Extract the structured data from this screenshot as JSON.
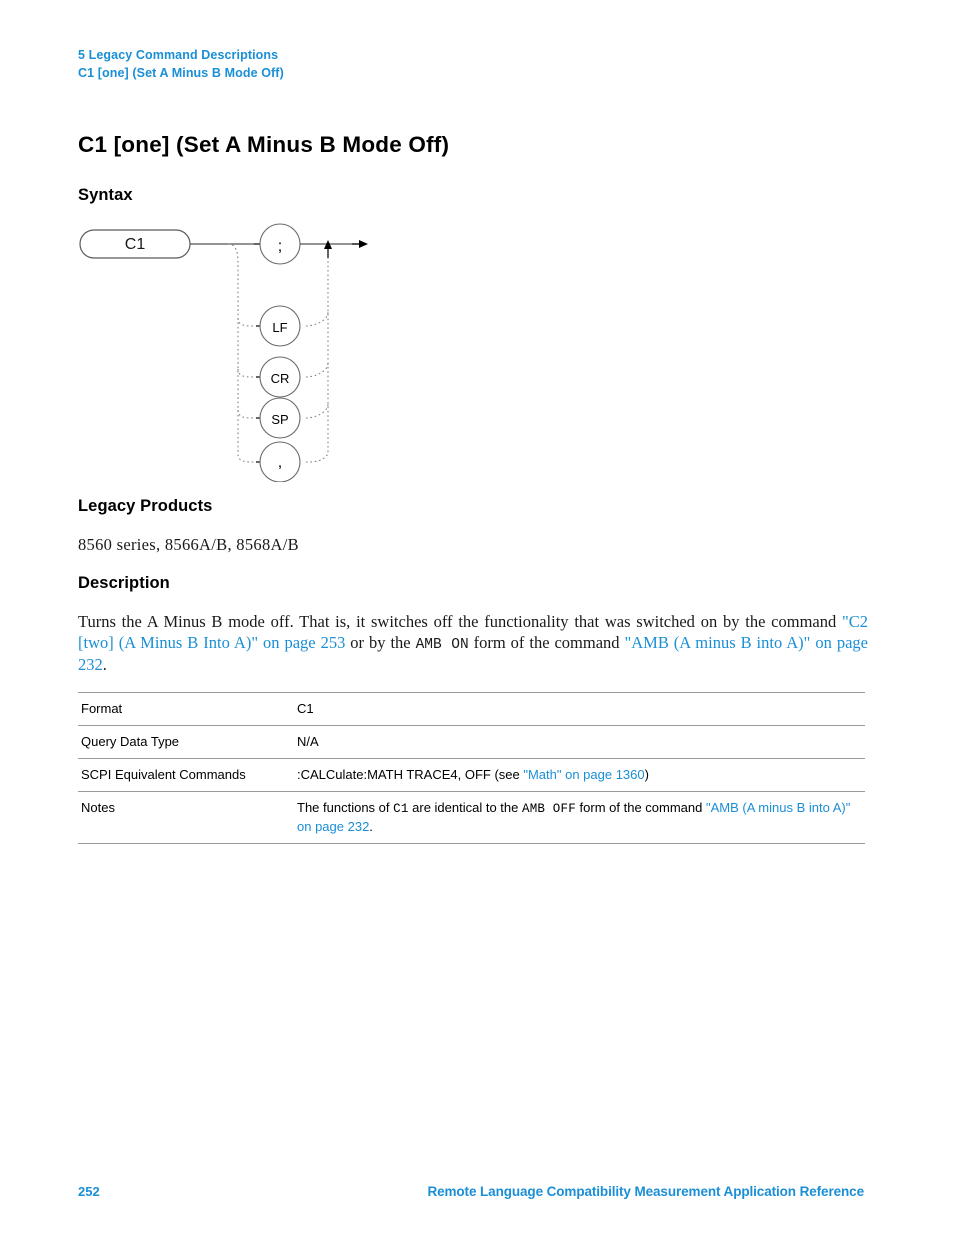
{
  "header": {
    "chapter": "5  Legacy Command Descriptions",
    "section": "C1 [one] (Set A Minus B Mode Off)"
  },
  "title": "C1 [one] (Set A Minus B Mode Off)",
  "sections": {
    "syntax_heading": "Syntax",
    "legacy_heading": "Legacy Products",
    "legacy_products": "8560 series, 8566A/B, 8568A/B",
    "description_heading": "Description"
  },
  "syntax_diagram": {
    "type": "railroad",
    "start_token": "C1",
    "terminators": [
      ";",
      "LF",
      "CR",
      "SP",
      ","
    ]
  },
  "description": {
    "part1": "Turns the A Minus B mode off. That is, it switches off the functionality that was switched on by the command ",
    "link1": "\"C2 [two] (A Minus B Into A)\" on page 253",
    "part2": " or by the ",
    "code1": "AMB  ON",
    "part3": " form of the command ",
    "link2": "\"AMB (A minus B into A)\" on page 232",
    "part4": "."
  },
  "table": {
    "rows": [
      {
        "label": "Format",
        "value": "C1"
      },
      {
        "label": "Query Data Type",
        "value": "N/A"
      },
      {
        "label": "SCPI Equivalent Commands",
        "value_prefix": ":CALCulate:MATH TRACE4, OFF (see ",
        "value_link": "\"Math\" on page 1360",
        "value_suffix": ")"
      },
      {
        "label": "Notes",
        "notes_part1": "The functions of ",
        "notes_code1": "C1",
        "notes_part2": " are identical to the ",
        "notes_code2": "AMB  OFF",
        "notes_part3": " form of the command ",
        "notes_link": "\"AMB (A minus B into A)\" on page 232",
        "notes_part4": "."
      }
    ]
  },
  "footer": {
    "page_number": "252",
    "document_title": "Remote Language Compatibility Measurement Application Reference"
  },
  "colors": {
    "link": "#1a8fd6",
    "text": "#000000",
    "rule": "#9a9a9a"
  }
}
